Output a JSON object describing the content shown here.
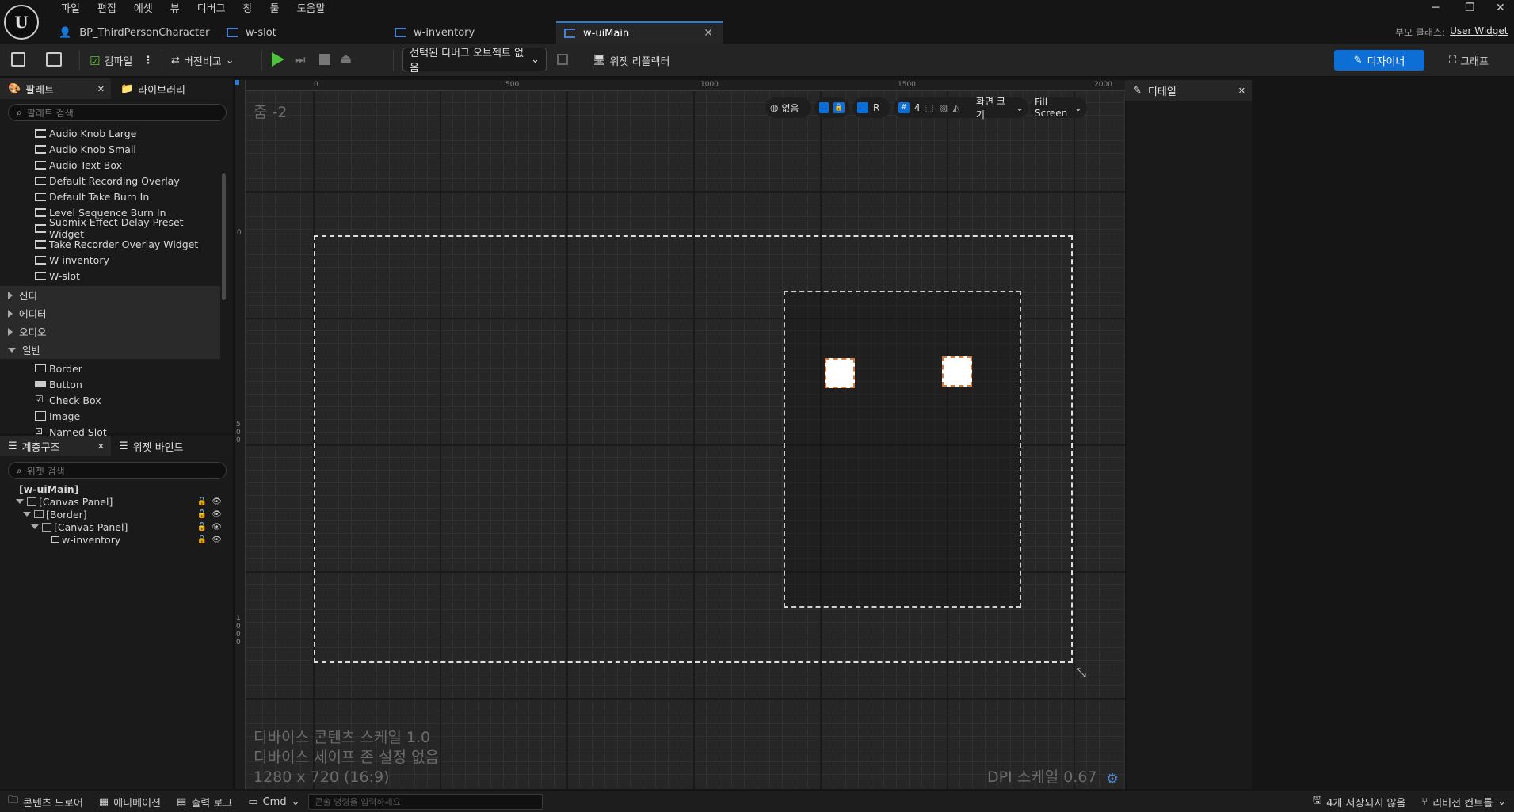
{
  "menu": [
    "파일",
    "편집",
    "에셋",
    "뷰",
    "디버그",
    "창",
    "툴",
    "도움말"
  ],
  "tabs": [
    {
      "label": "BP_ThirdPersonCharacter",
      "active": false
    },
    {
      "label": "w-slot",
      "active": false
    },
    {
      "label": "w-inventory",
      "active": false
    },
    {
      "label": "w-uiMain",
      "active": true
    }
  ],
  "parent_class": {
    "label": "부모 클래스:",
    "value": "User Widget"
  },
  "toolbar": {
    "compile": "컴파일",
    "diff": "버전비교",
    "debug_object": "선택된 디버그 오브젝트 없음",
    "widget_reflector": "위젯 리플렉터",
    "designer": "디자이너",
    "graph": "그래프"
  },
  "palette": {
    "tab_palette": "팔레트",
    "tab_library": "라이브러리",
    "search_placeholder": "팔레트 검색",
    "user_items": [
      "Audio Knob Large",
      "Audio Knob Small",
      "Audio Text Box",
      "Default Recording Overlay",
      "Default Take Burn In",
      "Level Sequence Burn In",
      "Submix Effect Delay Preset Widget",
      "Take Recorder Overlay Widget",
      "W-inventory",
      "W-slot"
    ],
    "categories": [
      "신디",
      "에디터",
      "오디오",
      "일반"
    ],
    "common_items": [
      "Border",
      "Button",
      "Check Box",
      "Image",
      "Named Slot"
    ]
  },
  "hierarchy": {
    "tab_hierarchy": "계층구조",
    "tab_binding": "위젯 바인드",
    "search_placeholder": "위젯 검색",
    "rows": [
      "[w-uiMain]",
      "[Canvas Panel]",
      "[Border]",
      "[Canvas Panel]",
      "w-inventory"
    ]
  },
  "viewport": {
    "zoom": "줌 -2",
    "ruler_top": [
      "0",
      "500",
      "1000",
      "1500",
      "2000"
    ],
    "ruler_left": [
      "0",
      "500",
      "1000"
    ],
    "none_label": "없음",
    "r_label": "R",
    "grid_count": "4",
    "screen_size": "화면 크기",
    "fill_mode": "Fill Screen",
    "device_scale": "디바이스 콘텐츠 스케일 1.0",
    "safe_zone": "디바이스 세이프 존 설정 없음",
    "resolution": "1280 x 720 (16:9)",
    "dpi_scale": "DPI 스케일 0.67"
  },
  "details": {
    "title": "디테일"
  },
  "bottom": {
    "content_drawer": "콘텐츠 드로어",
    "animation": "애니메이션",
    "output_log": "출력 로그",
    "cmd": "Cmd",
    "console_placeholder": "콘솔 명령을 입력하세요.",
    "unsaved": "4개 저장되지 않음",
    "revision": "리비전 컨트롤"
  }
}
